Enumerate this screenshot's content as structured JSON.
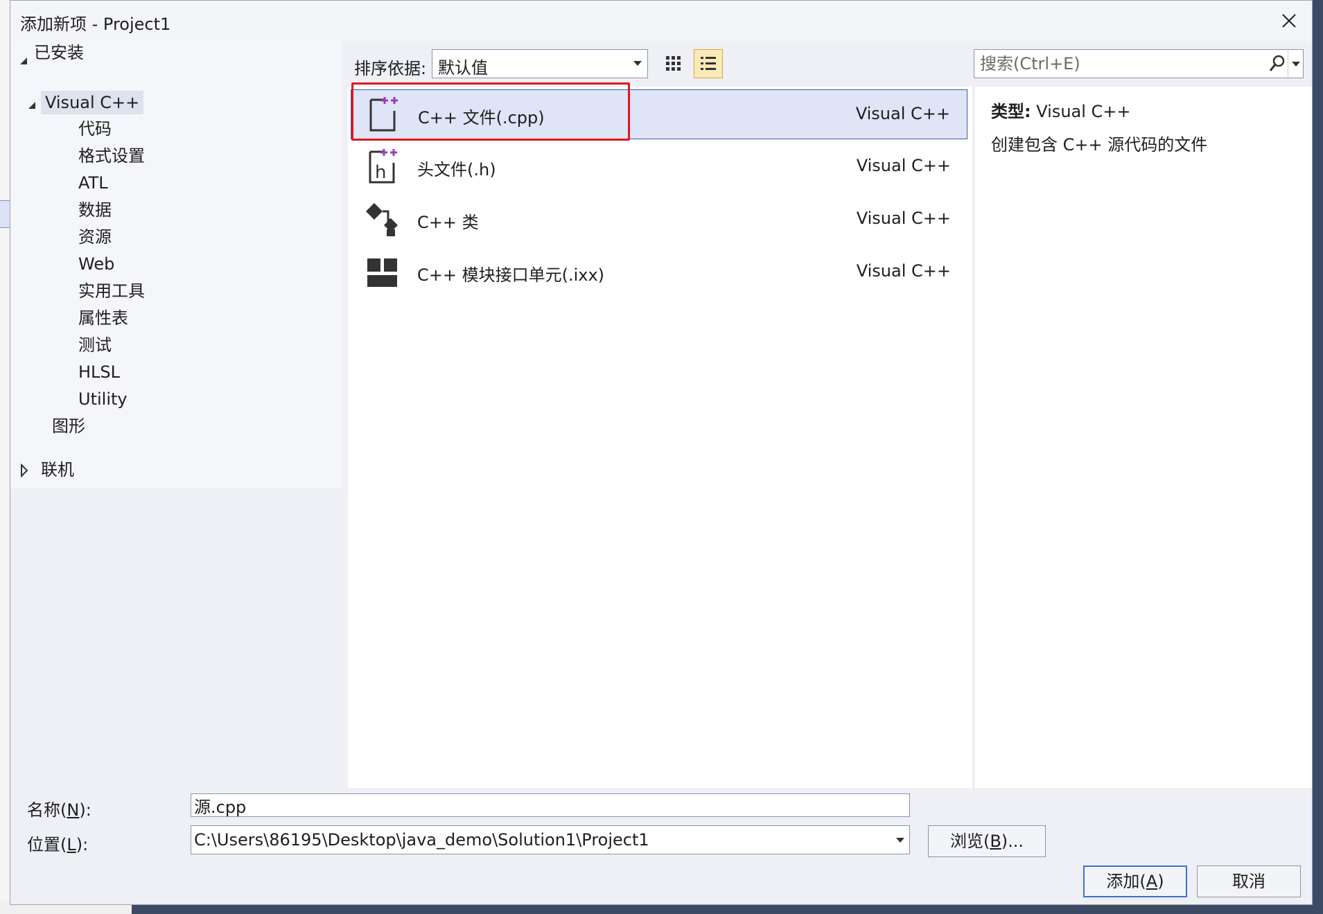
{
  "window": {
    "title": "添加新项 - Project1"
  },
  "tree": {
    "installed_label": "已安装",
    "root_label": "Visual C++",
    "children": [
      "代码",
      "格式设置",
      "ATL",
      "数据",
      "资源",
      "Web",
      "实用工具",
      "属性表",
      "测试",
      "HLSL",
      "Utility"
    ],
    "graphics_label": "图形",
    "online_label": "联机"
  },
  "toolbar": {
    "sort_label": "排序依据:",
    "sort_value": "默认值",
    "search_placeholder": "搜索(Ctrl+E)"
  },
  "templates": [
    {
      "name": "C++ 文件(.cpp)",
      "lang": "Visual C++",
      "icon": "cpp-file-icon",
      "selected": true
    },
    {
      "name": "头文件(.h)",
      "lang": "Visual C++",
      "icon": "header-file-icon",
      "selected": false
    },
    {
      "name": "C++ 类",
      "lang": "Visual C++",
      "icon": "class-icon",
      "selected": false
    },
    {
      "name": "C++ 模块接口单元(.ixx)",
      "lang": "Visual C++",
      "icon": "module-icon",
      "selected": false
    }
  ],
  "description": {
    "type_label": "类型:",
    "type_value": "Visual C++",
    "text": "创建包含 C++ 源代码的文件"
  },
  "form": {
    "name_label_pre": "名称(",
    "name_label_key": "N",
    "name_label_post": "):",
    "name_value": "源.cpp",
    "location_label_pre": "位置(",
    "location_label_key": "L",
    "location_label_post": "):",
    "location_value": "C:\\Users\\86195\\Desktop\\java_demo\\Solution1\\Project1",
    "browse_pre": "浏览(",
    "browse_key": "B",
    "browse_post": ")...",
    "add_pre": "添加(",
    "add_key": "A",
    "add_post": ")",
    "cancel_label": "取消"
  },
  "colors": {
    "accent": "#3d5ba9",
    "highlight_box": "#e3151d",
    "plus_purple": "#9b3fb5"
  }
}
